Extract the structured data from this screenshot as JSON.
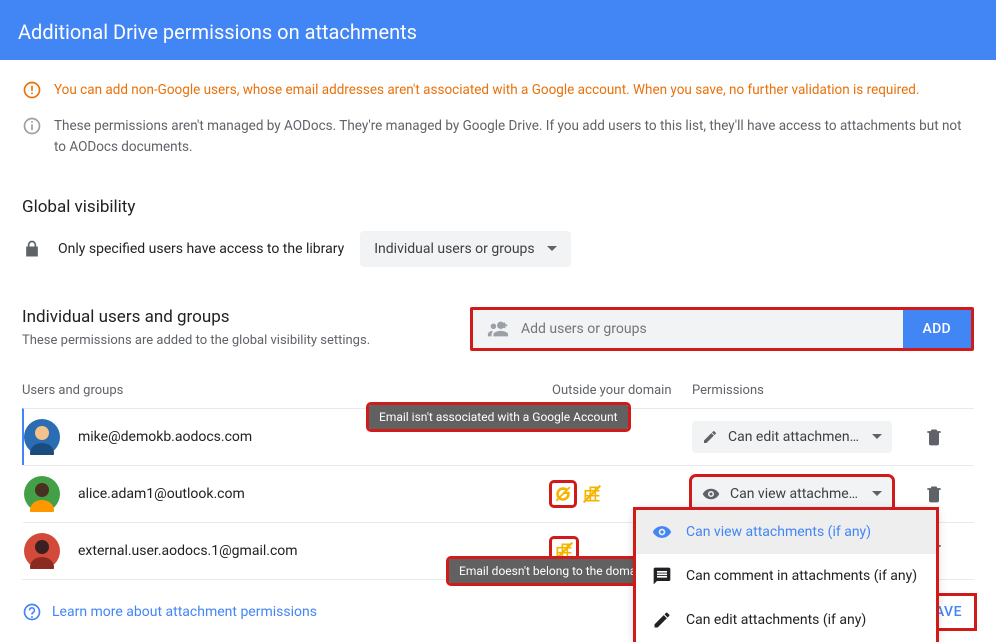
{
  "header": {
    "title": "Additional Drive permissions on attachments"
  },
  "banners": {
    "warn": "You can add non-Google users, whose email addresses aren't associated with a Google account. When you save, no further validation is required.",
    "info": "These permissions aren't managed by AODocs. They're managed by Google Drive. If you add users to this list, they'll have access to attachments but not to AODocs documents."
  },
  "global_visibility": {
    "title": "Global visibility",
    "text": "Only specified users have access to the library",
    "select_value": "Individual users or groups"
  },
  "individual": {
    "title": "Individual users and groups",
    "subtitle": "These permissions are added to the global visibility settings.",
    "input_placeholder": "Add users or groups",
    "add_label": "ADD"
  },
  "columns": {
    "c1": "Users and groups",
    "c2": "Outside your domain",
    "c3": "Permissions"
  },
  "rows": [
    {
      "email": "mike@demokb.aodocs.com",
      "avatar_bg": "radial-gradient(circle at 50% 35%, #f4c38b 30%, #2a6db3 30%)",
      "perm": "Can edit attachment…"
    },
    {
      "email": "alice.adam1@outlook.com",
      "avatar_bg": "radial-gradient(circle at 50% 35%, #4a3020 30%, #ff9800 30%)",
      "perm": "Can view attachment…"
    },
    {
      "email": "external.user.aodocs.1@gmail.com",
      "avatar_bg": "radial-gradient(circle at 50% 35%, #f0b89a 30%, #d44a3a 30%)",
      "perm": ""
    }
  ],
  "tooltips": {
    "not_google": "Email isn't associated with a Google Account",
    "not_domain": "Email doesn't belong to the domain"
  },
  "dropdown": {
    "options": [
      "Can view attachments (if any)",
      "Can comment in attachments (if any)",
      "Can edit attachments (if any)"
    ]
  },
  "footer": {
    "learn": "Learn more about attachment permissions",
    "save": "SAVE"
  }
}
